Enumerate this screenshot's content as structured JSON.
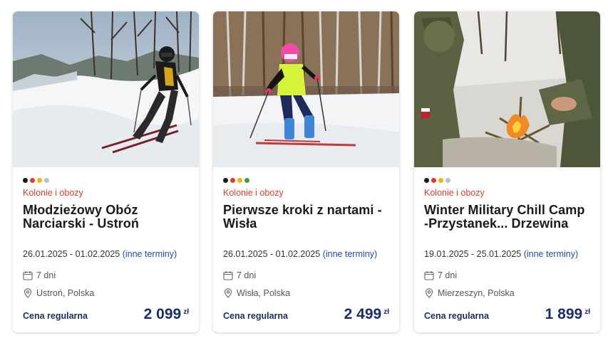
{
  "theme": {
    "category_color": "#e23a2e",
    "link_color": "#1f4fa3",
    "price_color": "#1a2d6b"
  },
  "cards": [
    {
      "image_icon": "skier-teen-photo",
      "dots": [
        "#1a1a1a",
        "#e23a2e",
        "#f2b705",
        "#c0c0c0"
      ],
      "category": "Kolonie i obozy",
      "title": "Młodzieżowy Obóz Narciarski - Ustroń",
      "dates": "26.01.2025 - 01.02.2025",
      "other_dates": "(inne terminy)",
      "duration": "7 dni",
      "location": "Ustroń, Polska",
      "price_label": "Cena regularna",
      "price": "2 099",
      "currency": "zł"
    },
    {
      "image_icon": "child-skier-photo",
      "dots": [
        "#1a1a1a",
        "#e23a2e",
        "#f2b705",
        "#3aa040"
      ],
      "category": "Kolonie i obozy",
      "title": "Pierwsze kroki z nartami - Wisła",
      "dates": "26.01.2025 - 01.02.2025",
      "other_dates": "(inne terminy)",
      "duration": "7 dni",
      "location": "Wisła, Polska",
      "price_label": "Cena regularna",
      "price": "2 499",
      "currency": "zł"
    },
    {
      "image_icon": "campfire-soldiers-photo",
      "dots": [
        "#1a1a1a",
        "#e23a2e",
        "#f2b705",
        "#c0c0c0"
      ],
      "category": "Kolonie i obozy",
      "title": "Winter Military Chill Camp -Przystanek... Drzewina",
      "dates": "19.01.2025 - 25.01.2025",
      "other_dates": "(inne terminy)",
      "duration": "7 dni",
      "location": "Mierzeszyn, Polska",
      "price_label": "Cena regularna",
      "price": "1 899",
      "currency": "zł"
    }
  ]
}
